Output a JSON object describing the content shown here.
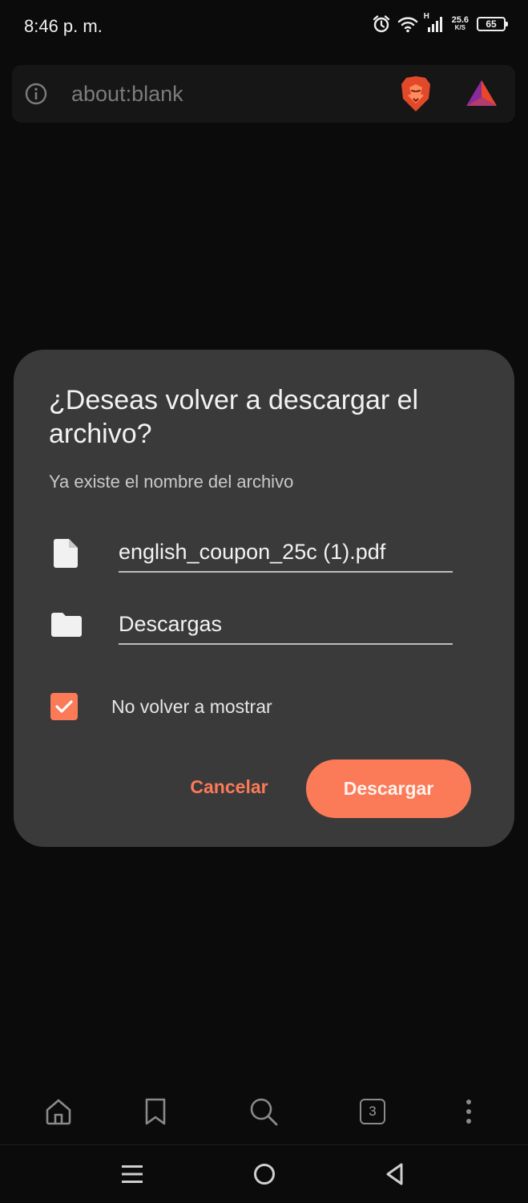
{
  "status_bar": {
    "time": "8:46 p. m.",
    "network_type": "H",
    "speed_value": "25.6",
    "speed_unit": "K/S",
    "battery_level": "65",
    "icons": [
      "alarm-icon",
      "wifi-icon",
      "signal-icon",
      "battery-icon"
    ]
  },
  "address_bar": {
    "url": "about:blank",
    "icons": [
      "info-icon",
      "brave-shields-icon",
      "brave-rewards-icon"
    ]
  },
  "dialog": {
    "title": "¿Deseas volver a descargar el archivo?",
    "subtitle": "Ya existe el nombre del archivo",
    "filename": "english_coupon_25c (1).pdf",
    "folder": "Descargas",
    "checkbox_label": "No volver a mostrar",
    "checkbox_checked": true,
    "cancel_label": "Cancelar",
    "download_label": "Descargar",
    "accent_color": "#fb7a57"
  },
  "toolbar": {
    "tab_count": "3",
    "icons": [
      "home-icon",
      "bookmark-icon",
      "search-icon",
      "tabs-icon",
      "menu-dots-icon"
    ]
  },
  "system_nav": {
    "icons": [
      "recents-icon",
      "home-circle-icon",
      "back-icon"
    ]
  }
}
